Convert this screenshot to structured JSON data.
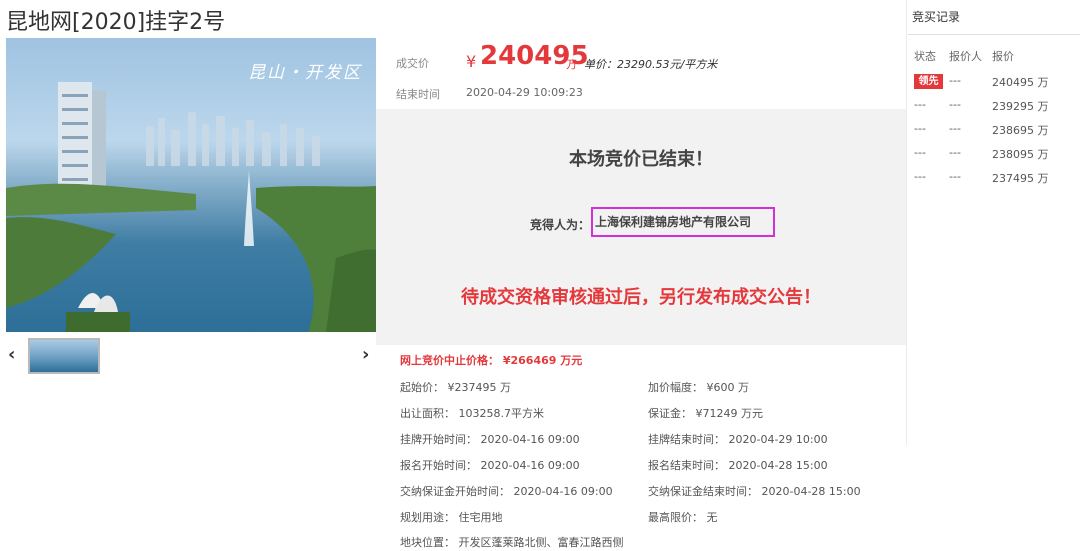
{
  "page_title": "昆地网[2020]挂字2号",
  "gallery": {
    "caption": "昆山・开发区",
    "prev_icon": "‹",
    "next_icon": "›"
  },
  "deal": {
    "price_label": "成交价",
    "currency": "¥",
    "price": "240495",
    "price_unit": "万",
    "unit_price": "单价：23290.53元/平方米",
    "end_time_label": "结束时间",
    "end_time": "2020-04-29 10:09:23"
  },
  "result_panel": {
    "ended_text": "本场竞价已结束！",
    "winner_label": "竞得人为：",
    "winner": "上海保利建锦房地产有限公司",
    "notice": "待成交资格审核通过后，另行发布成交公告！"
  },
  "details": {
    "stop_price": "网上竞价中止价格： ¥266469 万元",
    "rows": [
      [
        "起始价： ¥237495 万",
        "加价幅度： ¥600 万"
      ],
      [
        "出让面积： 103258.7平方米",
        "保证金： ¥71249 万元"
      ],
      [
        "挂牌开始时间： 2020-04-16 09:00",
        "挂牌结束时间： 2020-04-29 10:00"
      ],
      [
        "报名开始时间： 2020-04-16 09:00",
        "报名结束时间： 2020-04-28 15:00"
      ],
      [
        "交纳保证金开始时间： 2020-04-16 09:00",
        "交纳保证金结束时间： 2020-04-28 15:00"
      ],
      [
        "规划用途： 住宅用地",
        "最高限价： 无"
      ],
      [
        "地块位置： 开发区蓬莱路北侧、富春江路西侧",
        ""
      ]
    ]
  },
  "records": {
    "title": "竞买记录",
    "headers": [
      "状态",
      "报价人",
      "报价"
    ],
    "rows": [
      {
        "status": "领先",
        "bidder": "---",
        "price": "240495 万"
      },
      {
        "status": "---",
        "bidder": "---",
        "price": "239295 万"
      },
      {
        "status": "---",
        "bidder": "---",
        "price": "238695 万"
      },
      {
        "status": "---",
        "bidder": "---",
        "price": "238095 万"
      },
      {
        "status": "---",
        "bidder": "---",
        "price": "237495 万"
      }
    ]
  },
  "colors": {
    "accent_red": "#e4393c",
    "highlight_magenta": "#d230d9",
    "panel_gray": "#f2f2f2"
  }
}
